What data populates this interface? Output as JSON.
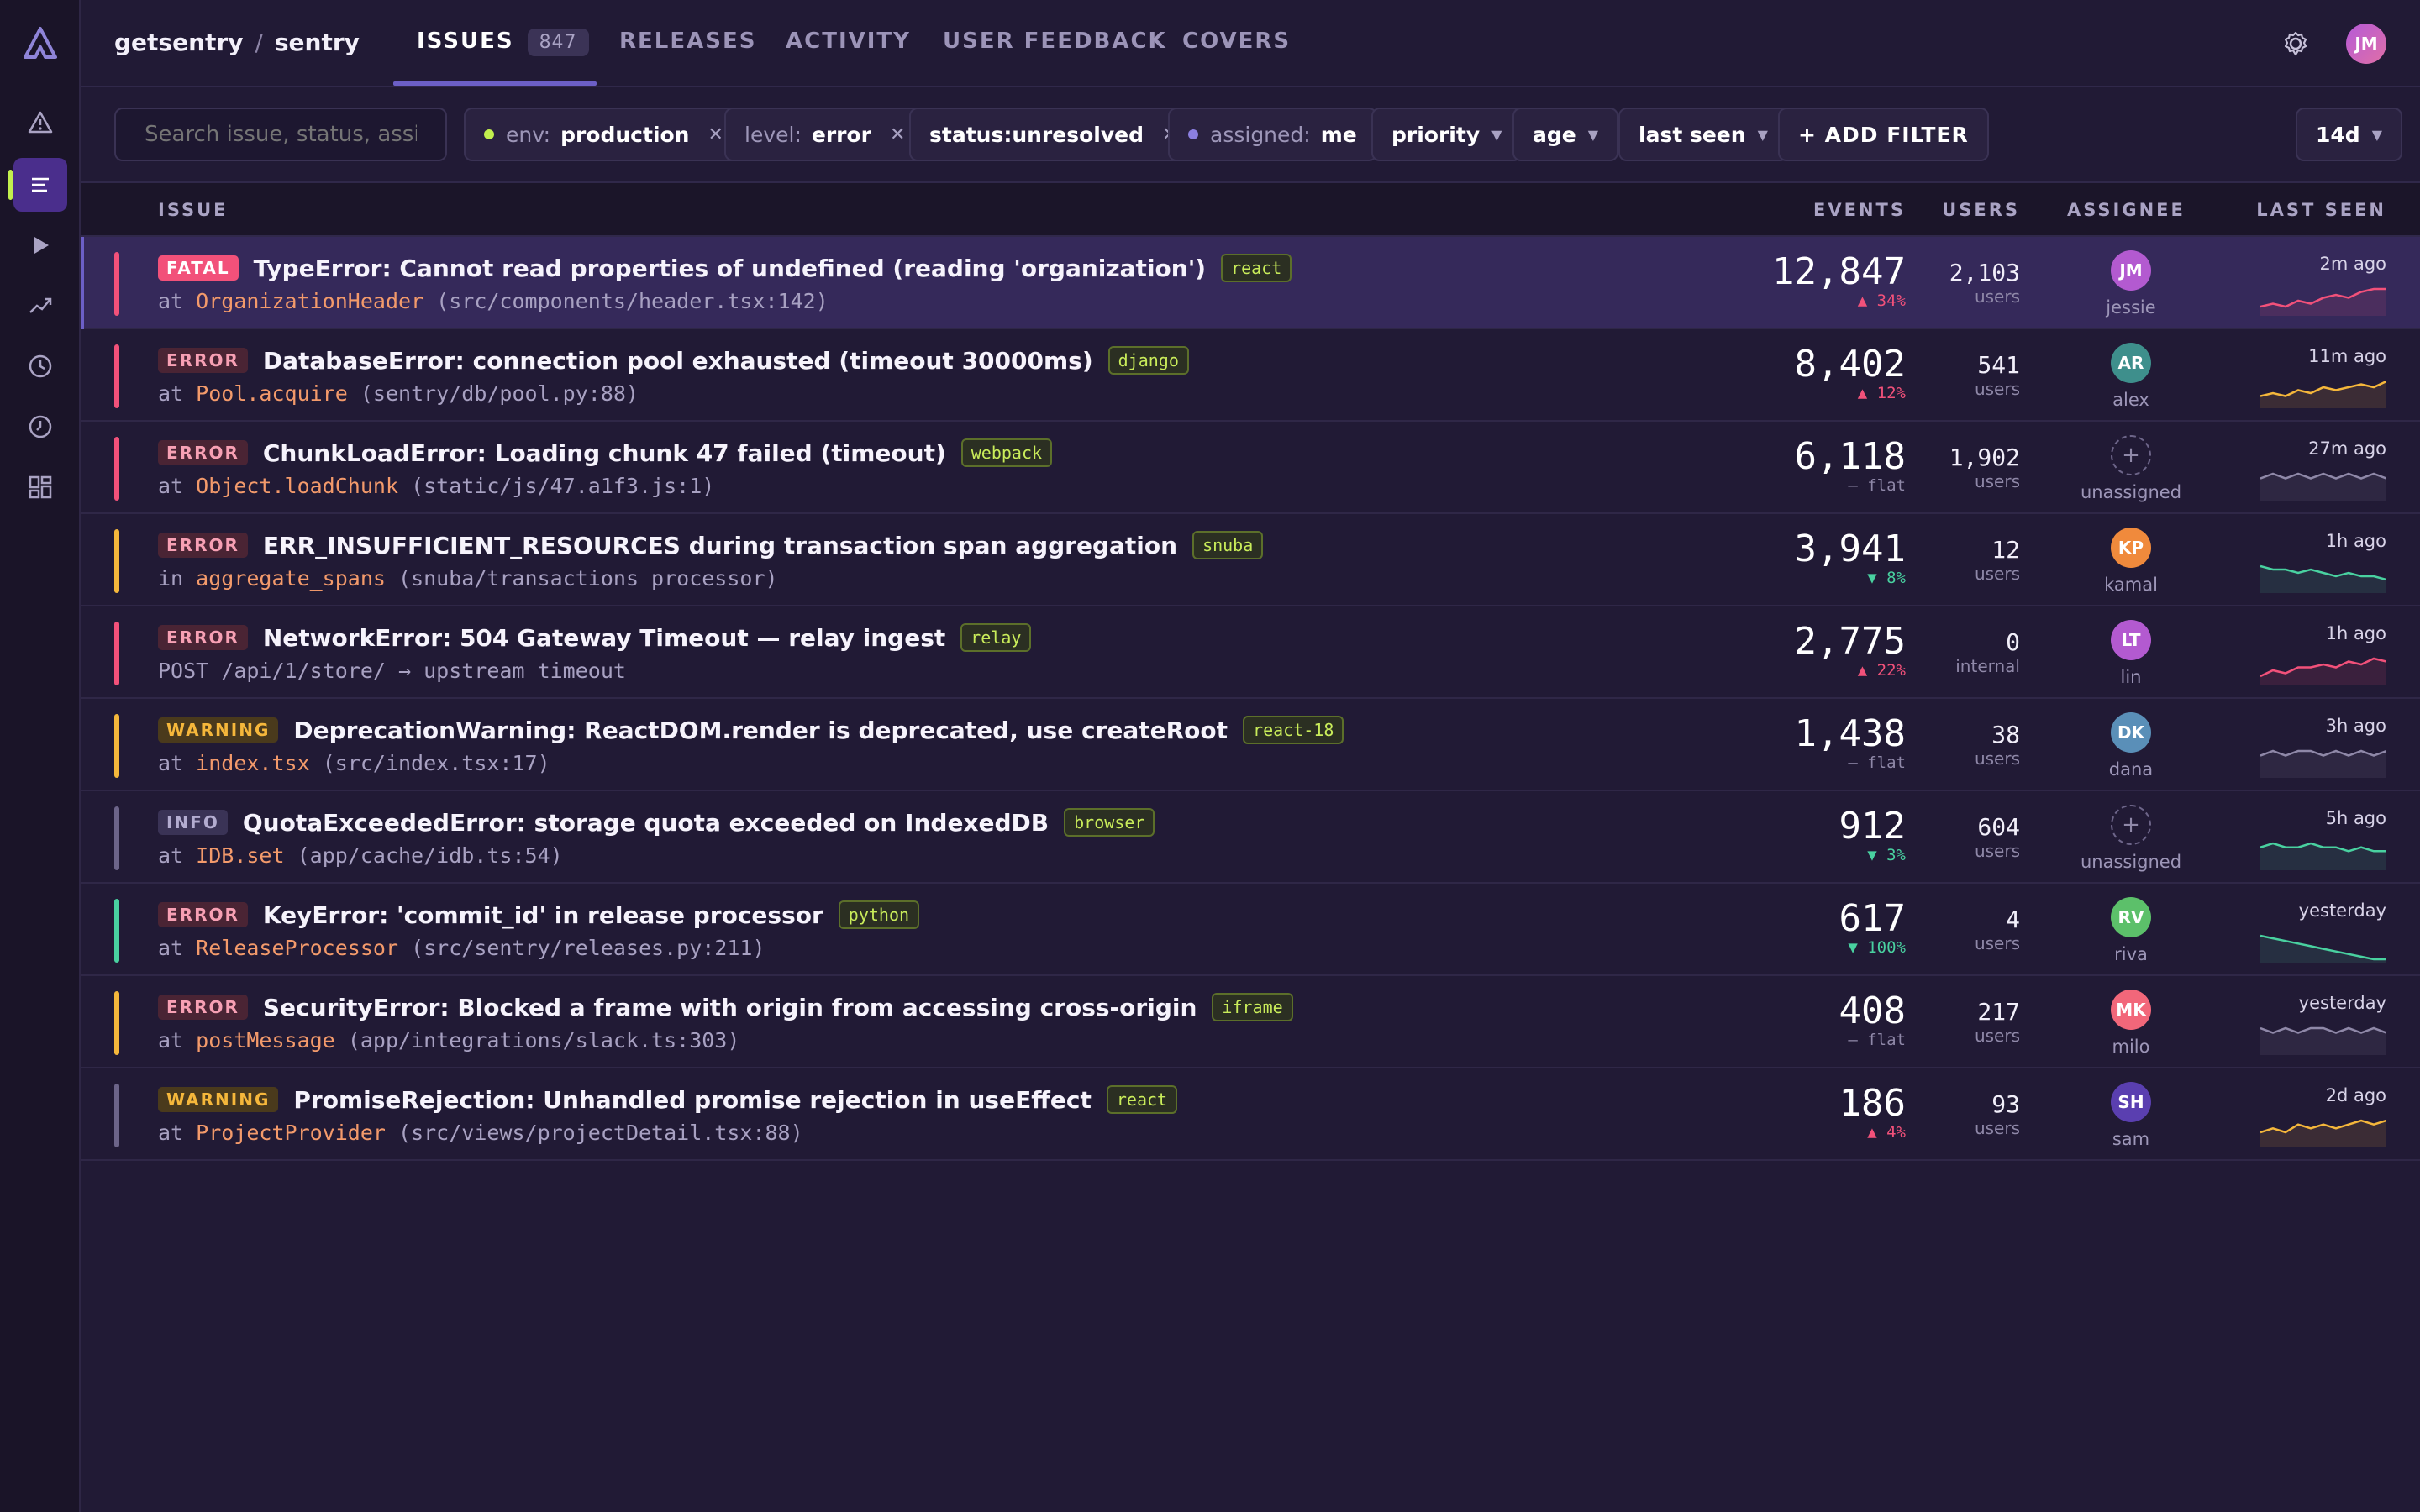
{
  "breadcrumb": {
    "org": "getsentry",
    "separator": "/",
    "project": "sentry"
  },
  "tabs": [
    {
      "label": "ISSUES",
      "count": "847",
      "active": true
    },
    {
      "label": "RELEASES"
    },
    {
      "label": "ACTIVITY"
    },
    {
      "label": "USER FEEDBACK"
    },
    {
      "label": "COVERS"
    }
  ],
  "user_avatar": "JM",
  "search": {
    "placeholder": "Search issue, status, assignee"
  },
  "filters": [
    {
      "key": "env:",
      "value": "production",
      "dot": "#c2ef4e",
      "removable": true
    },
    {
      "key": "level:",
      "value": "error",
      "removable": true
    },
    {
      "key": "",
      "value": "status:unresolved",
      "removable": true
    },
    {
      "key": "assigned:",
      "value": "me",
      "dot": "#8b7fe0",
      "removable": false
    }
  ],
  "dropdowns": [
    "priority",
    "age",
    "last seen"
  ],
  "add_filter": "+ ADD FILTER",
  "period": "14d",
  "columns": {
    "issue": "ISSUE",
    "events": "EVENTS",
    "users": "USERS",
    "assignee": "ASSIGNEE",
    "last_seen": "LAST SEEN"
  },
  "colors": {
    "fatal": "#f55476",
    "error": "#f2517a",
    "warning": "#f5b73b",
    "info": "#6c6489",
    "success": "#49d1a0",
    "accent": "#6c5fc7"
  },
  "issues": [
    {
      "level": "FATAL",
      "bar": "#f2517a",
      "title": "TypeError: Cannot read properties of undefined (reading 'organization')",
      "tag": "react",
      "prefix": "at",
      "fn": "OrganizationHeader",
      "loc": "(src/components/header.tsx:142)",
      "events": "12,847",
      "delta": "▲ 34%",
      "delta_color": "#f2517a",
      "users": "2,103",
      "users_label": "users",
      "assignee": "JM",
      "assignee_name": "jessie",
      "av_color": "#b35ad0",
      "last_seen": "2m ago",
      "spark": [
        2,
        3,
        2,
        4,
        3,
        5,
        6,
        5,
        7,
        8,
        8
      ],
      "spark_color": "#f2517a"
    },
    {
      "level": "ERROR",
      "bar": "#f2517a",
      "title": "DatabaseError: connection pool exhausted (timeout 30000ms)",
      "tag": "django",
      "prefix": "at",
      "fn": "Pool.acquire",
      "loc": "(sentry/db/pool.py:88)",
      "events": "8,402",
      "delta": "▲ 12%",
      "delta_color": "#f2517a",
      "users": "541",
      "users_label": "users",
      "assignee": "AR",
      "assignee_name": "alex",
      "av_color": "#3e8f8c",
      "last_seen": "11m ago",
      "spark": [
        3,
        4,
        3,
        5,
        4,
        6,
        5,
        6,
        7,
        6,
        8
      ],
      "spark_color": "#f5b73b"
    },
    {
      "level": "ERROR",
      "bar": "#f2517a",
      "title": "ChunkLoadError: Loading chunk 47 failed (timeout)",
      "tag": "webpack",
      "prefix": "at",
      "fn": "Object.loadChunk",
      "loc": "(static/js/47.a1f3.js:1)",
      "events": "6,118",
      "delta": "— flat",
      "delta_color": "#8f88a8",
      "users": "1,902",
      "users_label": "users",
      "assignee": "+",
      "assignee_name": "unassigned",
      "av_color": "",
      "last_seen": "27m ago",
      "spark": [
        4,
        5,
        4,
        5,
        4,
        5,
        4,
        5,
        4,
        5,
        4
      ],
      "spark_color": "#8f88a8"
    },
    {
      "level": "ERROR",
      "bar": "#f5b73b",
      "title": "ERR_INSUFFICIENT_RESOURCES during transaction span aggregation",
      "tag": "snuba",
      "prefix": "in",
      "fn": "aggregate_spans",
      "loc": "(snuba/transactions processor)",
      "events": "3,941",
      "delta": "▼ 8%",
      "delta_color": "#49d1a0",
      "users": "12",
      "users_label": "users",
      "assignee": "KP",
      "assignee_name": "kamal",
      "av_color": "#f08a3c",
      "last_seen": "1h ago",
      "spark": [
        7,
        6,
        6,
        5,
        6,
        5,
        4,
        5,
        4,
        4,
        3
      ],
      "spark_color": "#49d1a0"
    },
    {
      "level": "ERROR",
      "bar": "#f2517a",
      "title": "NetworkError: 504 Gateway Timeout — relay ingest",
      "tag": "relay",
      "prefix": "POST",
      "fn": "",
      "loc": "/api/1/store/ → upstream timeout",
      "events": "2,775",
      "delta": "▲ 22%",
      "delta_color": "#f2517a",
      "users": "0",
      "users_label": "internal",
      "assignee": "LT",
      "assignee_name": "lin",
      "av_color": "#b35ad0",
      "last_seen": "1h ago",
      "spark": [
        2,
        4,
        3,
        5,
        5,
        6,
        5,
        7,
        6,
        8,
        7
      ],
      "spark_color": "#f2517a"
    },
    {
      "level": "WARNING",
      "bar": "#f5b73b",
      "title": "DeprecationWarning: ReactDOM.render is deprecated, use createRoot",
      "tag": "react-18",
      "prefix": "at",
      "fn": "index.tsx",
      "loc": "(src/index.tsx:17)",
      "events": "1,438",
      "delta": "— flat",
      "delta_color": "#8f88a8",
      "users": "38",
      "users_label": "users",
      "assignee": "DK",
      "assignee_name": "dana",
      "av_color": "#5a8fb8",
      "last_seen": "3h ago",
      "spark": [
        4,
        5,
        4,
        5,
        5,
        4,
        5,
        4,
        5,
        4,
        5
      ],
      "spark_color": "#8f88a8"
    },
    {
      "level": "INFO",
      "bar": "#6c6489",
      "title": "QuotaExceededError: storage quota exceeded on IndexedDB",
      "tag": "browser",
      "prefix": "at",
      "fn": "IDB.set",
      "loc": "(app/cache/idb.ts:54)",
      "events": "912",
      "delta": "▼ 3%",
      "delta_color": "#49d1a0",
      "users": "604",
      "users_label": "users",
      "assignee": "+",
      "assignee_name": "unassigned",
      "av_color": "",
      "last_seen": "5h ago",
      "spark": [
        5,
        6,
        5,
        5,
        6,
        5,
        5,
        4,
        5,
        4,
        4
      ],
      "spark_color": "#49d1a0"
    },
    {
      "level": "ERROR",
      "bar": "#49d1a0",
      "title": "KeyError: 'commit_id' in release processor",
      "tag": "python",
      "prefix": "at",
      "fn": "ReleaseProcessor",
      "loc": "(src/sentry/releases.py:211)",
      "events": "617",
      "delta": "▼ 100%",
      "delta_color": "#49d1a0",
      "users": "4",
      "users_label": "users",
      "assignee": "RV",
      "assignee_name": "riva",
      "av_color": "#5cc06a",
      "last_seen": "yesterday",
      "spark": [
        9,
        8,
        7,
        6,
        5,
        4,
        3,
        2,
        1,
        0,
        0
      ],
      "spark_color": "#49d1a0"
    },
    {
      "level": "ERROR",
      "bar": "#f5b73b",
      "title": "SecurityError: Blocked a frame with origin from accessing cross-origin",
      "tag": "iframe",
      "prefix": "at",
      "fn": "postMessage",
      "loc": "(app/integrations/slack.ts:303)",
      "events": "408",
      "delta": "— flat",
      "delta_color": "#8f88a8",
      "users": "217",
      "users_label": "users",
      "assignee": "MK",
      "assignee_name": "milo",
      "av_color": "#f2677a",
      "last_seen": "yesterday",
      "spark": [
        5,
        4,
        5,
        4,
        5,
        5,
        4,
        5,
        4,
        5,
        4
      ],
      "spark_color": "#8f88a8"
    },
    {
      "level": "WARNING",
      "bar": "#6c6489",
      "title": "PromiseRejection: Unhandled promise rejection in  useEffect",
      "tag": "react",
      "prefix": "at",
      "fn": "ProjectProvider",
      "loc": "(src/views/projectDetail.tsx:88)",
      "events": "186",
      "delta": "▲ 4%",
      "delta_color": "#f2517a",
      "users": "93",
      "users_label": "users",
      "assignee": "SH",
      "assignee_name": "sam",
      "av_color": "#5a3fb0",
      "last_seen": "2d ago",
      "spark": [
        3,
        4,
        3,
        5,
        4,
        5,
        4,
        5,
        6,
        5,
        6
      ],
      "spark_color": "#f5b73b"
    }
  ]
}
